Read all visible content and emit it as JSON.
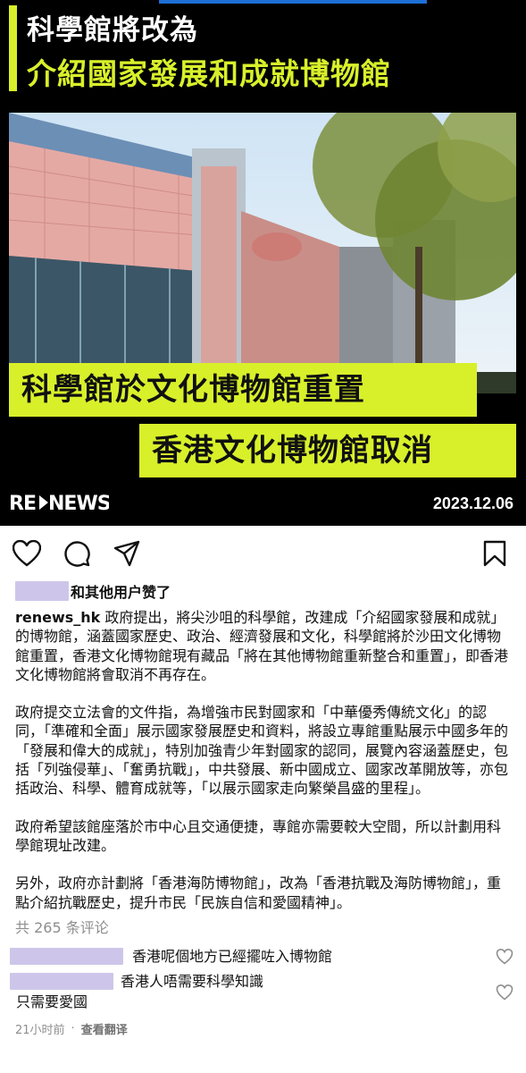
{
  "post_image": {
    "headline_1": "科學館將改為",
    "headline_2": "介紹國家發展和成就博物館",
    "caption_1": "科學館於文化博物館重置",
    "caption_2": "香港文化博物館取消",
    "brand": "RE NEWS",
    "date": "2023.12.06",
    "accent_color": "#d8f02a"
  },
  "actions": {
    "icons": [
      "heart-outline-icon",
      "comment-icon",
      "share-icon",
      "bookmark-icon"
    ]
  },
  "likes": {
    "text": "和其他用户赞了"
  },
  "caption": {
    "username": "renews_hk",
    "paragraph_1": " 政府提出，將尖沙咀的科學館，改建成「介紹國家發展和成就」的博物館，涵蓋國家歷史、政治、經濟發展和文化，科學館將於沙田文化博物館重置，香港文化博物館現有藏品「將在其他博物館重新整合和重置」，即香港文化博物館將會取消不再存在。",
    "paragraph_2": "政府提交立法會的文件指，為增強市民對國家和「中華優秀傳統文化」的認同，「準確和全面」展示國家發展歷史和資料，將設立專館重點展示中國多年的「發展和偉大的成就」，特別加強青少年對國家的認同，展覽內容涵蓋歷史，包括「列強侵華」、「奮勇抗戰」，中共發展、新中國成立、國家改革開放等，亦包括政治、科學、體育成就等，「以展示國家走向繁榮昌盛的里程」。",
    "paragraph_3": "政府希望該館座落於市中心且交通便捷，專館亦需要較大空間，所以計劃用科學館現址改建。",
    "paragraph_4": "另外，政府亦計劃將「香港海防博物館」，改為「香港抗戰及海防博物館」，重點介紹抗戰歷史，提升市民「民族自信和愛國精神」。"
  },
  "comments_count": "共 265 条评论",
  "comments": [
    {
      "text": "香港呢個地方已經擺咗入博物館"
    },
    {
      "text_1": "香港人唔需要科學知識",
      "text_2": "只需要愛國"
    }
  ],
  "meta": {
    "time": "21小时前",
    "dot": "·",
    "translate": "查看翻译"
  }
}
